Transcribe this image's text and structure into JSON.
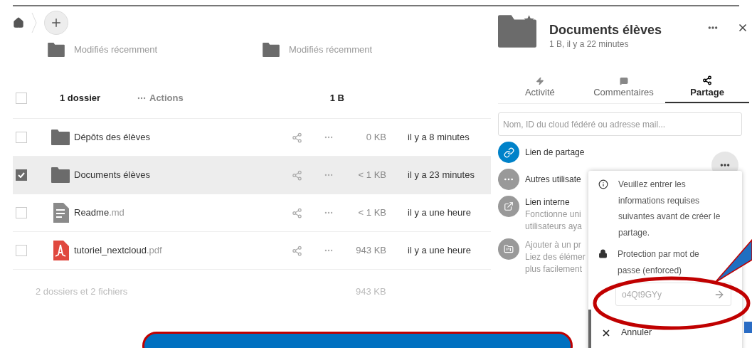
{
  "recent": [
    {
      "subtitle": "Modifiés récemment"
    },
    {
      "subtitle": "Modifiés récemment"
    }
  ],
  "table": {
    "header": {
      "selected": false,
      "count": "1 dossier",
      "actions": "Actions",
      "size": "1 B"
    },
    "rows": [
      {
        "kind": "folder",
        "name": "Dépôts des élèves",
        "ext": "",
        "size": "0 KB",
        "modified": "il y a 8 minutes",
        "selected": false
      },
      {
        "kind": "folder",
        "name": "Documents élèves",
        "ext": "",
        "size": "< 1 KB",
        "modified": "il y a 23 minutes",
        "selected": true
      },
      {
        "kind": "text",
        "name": "Readme",
        "ext": ".md",
        "size": "< 1 KB",
        "modified": "il y a une heure",
        "selected": false
      },
      {
        "kind": "pdf",
        "name": "tutoriel_nextcloud",
        "ext": ".pdf",
        "size": "943 KB",
        "modified": "il y a une heure",
        "selected": false
      }
    ],
    "summary": {
      "label": "2 dossiers et 2 fichiers",
      "size": "943 KB"
    }
  },
  "sidebar": {
    "title": "Documents élèves",
    "subtitle": "1 B, il y a 22 minutes",
    "tabs": [
      {
        "kind": "activity",
        "label": "Activité",
        "selected": false
      },
      {
        "kind": "comments",
        "label": "Commentaires",
        "selected": false
      },
      {
        "kind": "share",
        "label": "Partage",
        "selected": true
      }
    ],
    "search": {
      "placeholder": "Nom, ID du cloud fédéré ou adresse mail..."
    },
    "share_items": [
      {
        "kind": "link",
        "label": "Lien de partage"
      },
      {
        "kind": "others",
        "label": "Autres utilisate"
      },
      {
        "kind": "internal",
        "label": "Lien interne",
        "lines": [
          "Fonctionne uni",
          "utilisateurs aya"
        ]
      },
      {
        "kind": "project",
        "lines": [
          "Ajouter à un pr",
          "Liez des élémer",
          "plus facilement"
        ]
      }
    ],
    "popover": {
      "info": "Veuillez entrer les informations requises suivantes avant de créer le partage.",
      "password_label": "Protection par mot de passe (enforced)",
      "password_value": "o4Qt9GYy",
      "cancel": "Annuler"
    }
  }
}
